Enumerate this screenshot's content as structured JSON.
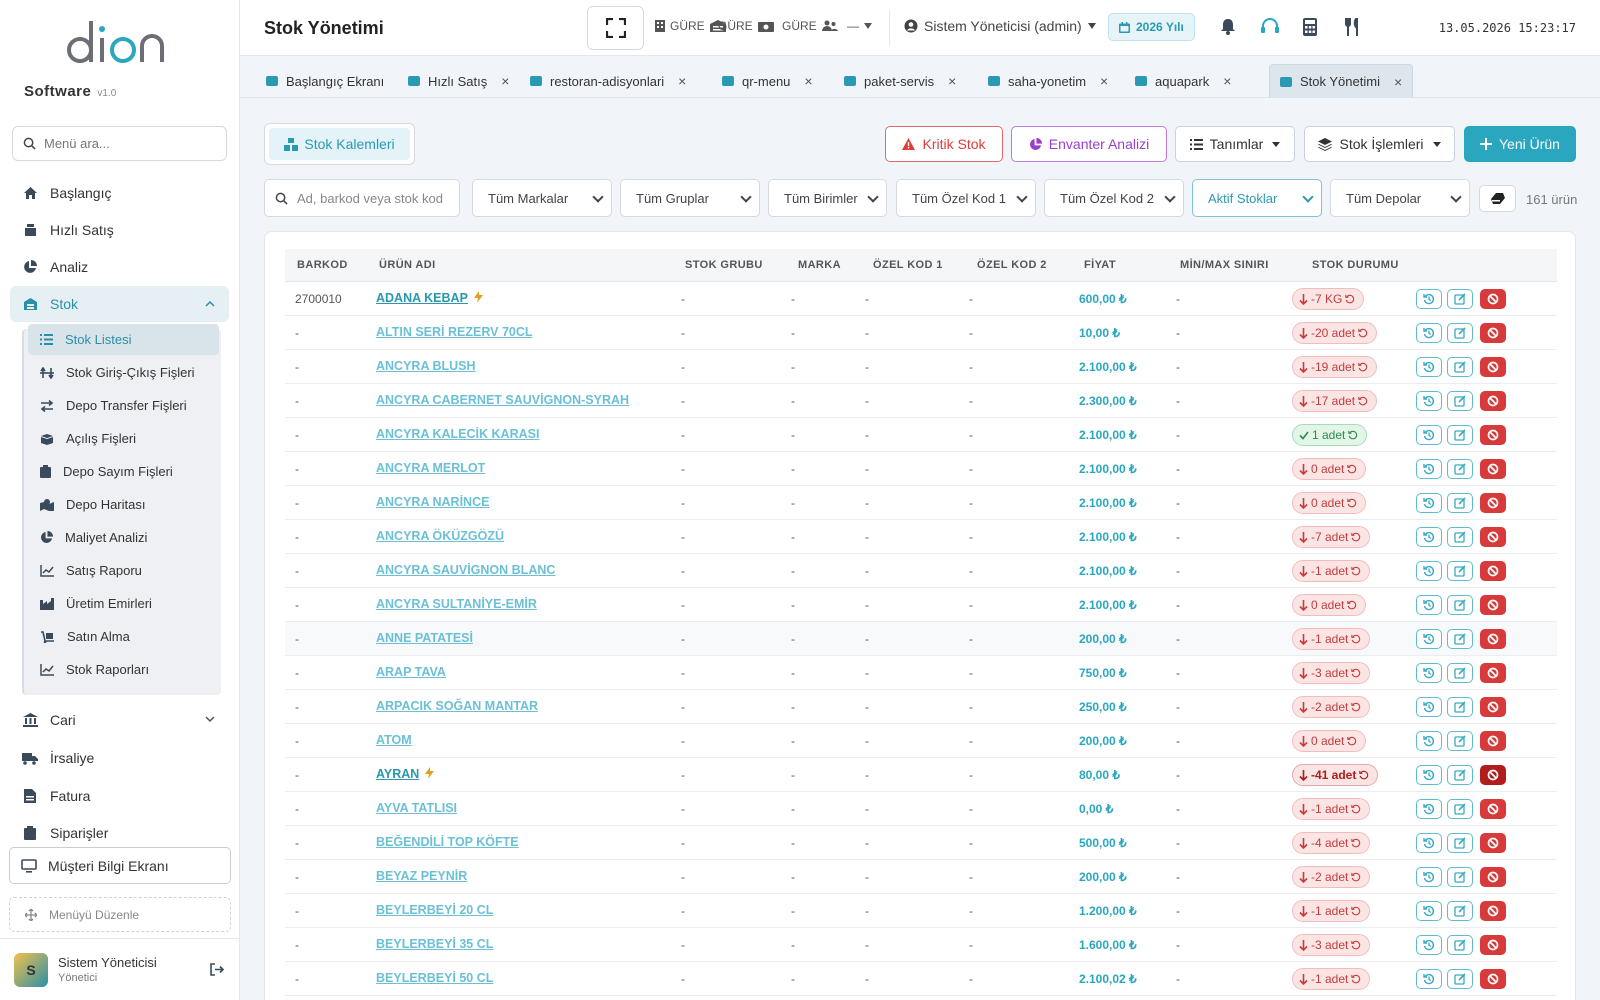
{
  "sidebar": {
    "brand": "Software",
    "version": "v1.0",
    "search_placeholder": "Menü ara...",
    "items": [
      {
        "label": "Başlangıç"
      },
      {
        "label": "Hızlı Satış"
      },
      {
        "label": "Analiz"
      },
      {
        "label": "Stok"
      },
      {
        "label": "Cari"
      },
      {
        "label": "İrsaliye"
      },
      {
        "label": "Fatura"
      },
      {
        "label": "Siparişler"
      }
    ],
    "submenu": [
      {
        "label": "Stok Listesi"
      },
      {
        "label": "Stok Giriş-Çıkış Fişleri"
      },
      {
        "label": "Depo Transfer Fişleri"
      },
      {
        "label": "Açılış Fişleri"
      },
      {
        "label": "Depo Sayım Fişleri"
      },
      {
        "label": "Depo Haritası"
      },
      {
        "label": "Maliyet Analizi"
      },
      {
        "label": "Satış Raporu"
      },
      {
        "label": "Üretim Emirleri"
      },
      {
        "label": "Satın Alma"
      },
      {
        "label": "Stok Raporları"
      }
    ],
    "customer_screen": "Müşteri Bilgi Ekranı",
    "edit_menu": "Menüyü Düzenle",
    "user": {
      "initial": "S",
      "name": "Sistem Yöneticisi",
      "role": "Yönetici"
    }
  },
  "topbar": {
    "title": "Stok Yönetimi",
    "stations": [
      "GÜRE",
      "GÜRE",
      "GÜRE",
      "—"
    ],
    "user": "Sistem Yöneticisi (admin)",
    "year": "2026 Yılı",
    "datetime": "13.05.2026 15:23:17"
  },
  "tabs": [
    {
      "label": "Başlangıç Ekranı"
    },
    {
      "label": "Hızlı Satış"
    },
    {
      "label": "restoran-adisyonlari"
    },
    {
      "label": "qr-menu"
    },
    {
      "label": "paket-servis"
    },
    {
      "label": "saha-yonetim"
    },
    {
      "label": "aquapark"
    },
    {
      "label": "Stok Yönetimi"
    }
  ],
  "toolbar": {
    "stock_items": "Stok Kalemleri",
    "critical": "Kritik Stok",
    "inventory": "Envanter Analizi",
    "definitions": "Tanımlar",
    "operations": "Stok İşlemleri",
    "new_product": "Yeni Ürün"
  },
  "filters": {
    "search_placeholder": "Ad, barkod veya stok kod",
    "brands": "Tüm Markalar",
    "groups": "Tüm Gruplar",
    "units": "Tüm Birimler",
    "code1": "Tüm Özel Kod 1",
    "code2": "Tüm Özel Kod 2",
    "status": "Aktif Stoklar",
    "warehouses": "Tüm Depolar",
    "count": "161 ürün"
  },
  "table": {
    "headers": [
      "BARKOD",
      "ÜRÜN ADI",
      "STOK GRUBU",
      "MARKA",
      "ÖZEL KOD 1",
      "ÖZEL KOD 2",
      "FİYAT",
      "MİN/MAX SINIRI",
      "STOK DURUMU"
    ],
    "rows": [
      {
        "barcode": "2700010",
        "name": "ADANA KEBAP",
        "group": "-",
        "brand": "-",
        "code1": "-",
        "code2": "-",
        "price": "600,00 ₺",
        "minmax": "-",
        "stock": "-7 KG"
      },
      {
        "barcode": "-",
        "name": "ALTIN SERİ REZERV 70CL",
        "group": "-",
        "brand": "-",
        "code1": "-",
        "code2": "-",
        "price": "10,00 ₺",
        "minmax": "-",
        "stock": "-20 adet"
      },
      {
        "barcode": "-",
        "name": "ANCYRA BLUSH",
        "group": "-",
        "brand": "-",
        "code1": "-",
        "code2": "-",
        "price": "2.100,00 ₺",
        "minmax": "-",
        "stock": "-19 adet"
      },
      {
        "barcode": "-",
        "name": "ANCYRA CABERNET SAUVİGNON-SYRAH",
        "group": "-",
        "brand": "-",
        "code1": "-",
        "code2": "-",
        "price": "2.300,00 ₺",
        "minmax": "-",
        "stock": "-17 adet"
      },
      {
        "barcode": "-",
        "name": "ANCYRA KALECİK KARASI",
        "group": "-",
        "brand": "-",
        "code1": "-",
        "code2": "-",
        "price": "2.100,00 ₺",
        "minmax": "-",
        "stock": "1 adet"
      },
      {
        "barcode": "-",
        "name": "ANCYRA MERLOT",
        "group": "-",
        "brand": "-",
        "code1": "-",
        "code2": "-",
        "price": "2.100,00 ₺",
        "minmax": "-",
        "stock": "0 adet"
      },
      {
        "barcode": "-",
        "name": "ANCYRA NARİNCE",
        "group": "-",
        "brand": "-",
        "code1": "-",
        "code2": "-",
        "price": "2.100,00 ₺",
        "minmax": "-",
        "stock": "0 adet"
      },
      {
        "barcode": "-",
        "name": "ANCYRA ÖKÜZGÖZÜ",
        "group": "-",
        "brand": "-",
        "code1": "-",
        "code2": "-",
        "price": "2.100,00 ₺",
        "minmax": "-",
        "stock": "-7 adet"
      },
      {
        "barcode": "-",
        "name": "ANCYRA SAUVİGNON BLANC",
        "group": "-",
        "brand": "-",
        "code1": "-",
        "code2": "-",
        "price": "2.100,00 ₺",
        "minmax": "-",
        "stock": "-1 adet"
      },
      {
        "barcode": "-",
        "name": "ANCYRA SULTANİYE-EMİR",
        "group": "-",
        "brand": "-",
        "code1": "-",
        "code2": "-",
        "price": "2.100,00 ₺",
        "minmax": "-",
        "stock": "0 adet"
      },
      {
        "barcode": "-",
        "name": "ANNE PATATESİ",
        "group": "-",
        "brand": "-",
        "code1": "-",
        "code2": "-",
        "price": "200,00 ₺",
        "minmax": "-",
        "stock": "-1 adet"
      },
      {
        "barcode": "-",
        "name": "ARAP TAVA",
        "group": "-",
        "brand": "-",
        "code1": "-",
        "code2": "-",
        "price": "750,00 ₺",
        "minmax": "-",
        "stock": "-3 adet"
      },
      {
        "barcode": "-",
        "name": "ARPACIK SOĞAN MANTAR",
        "group": "-",
        "brand": "-",
        "code1": "-",
        "code2": "-",
        "price": "250,00 ₺",
        "minmax": "-",
        "stock": "-2 adet"
      },
      {
        "barcode": "-",
        "name": "ATOM",
        "group": "-",
        "brand": "-",
        "code1": "-",
        "code2": "-",
        "price": "200,00 ₺",
        "minmax": "-",
        "stock": "0 adet"
      },
      {
        "barcode": "-",
        "name": "AYRAN",
        "group": "-",
        "brand": "-",
        "code1": "-",
        "code2": "-",
        "price": "80,00 ₺",
        "minmax": "-",
        "stock": "-41 adet"
      },
      {
        "barcode": "-",
        "name": "AYVA TATLISI",
        "group": "-",
        "brand": "-",
        "code1": "-",
        "code2": "-",
        "price": "0,00 ₺",
        "minmax": "-",
        "stock": "-1 adet"
      },
      {
        "barcode": "-",
        "name": "BEĞENDİLİ TOP KÖFTE",
        "group": "-",
        "brand": "-",
        "code1": "-",
        "code2": "-",
        "price": "500,00 ₺",
        "minmax": "-",
        "stock": "-4 adet"
      },
      {
        "barcode": "-",
        "name": "BEYAZ PEYNİR",
        "group": "-",
        "brand": "-",
        "code1": "-",
        "code2": "-",
        "price": "200,00 ₺",
        "minmax": "-",
        "stock": "-2 adet"
      },
      {
        "barcode": "-",
        "name": "BEYLERBEYİ 20 CL",
        "group": "-",
        "brand": "-",
        "code1": "-",
        "code2": "-",
        "price": "1.200,00 ₺",
        "minmax": "-",
        "stock": "-1 adet"
      },
      {
        "barcode": "-",
        "name": "BEYLERBEYİ 35 CL",
        "group": "-",
        "brand": "-",
        "code1": "-",
        "code2": "-",
        "price": "1.600,00 ₺",
        "minmax": "-",
        "stock": "-3 adet"
      },
      {
        "barcode": "-",
        "name": "BEYLERBEYİ 50 CL",
        "group": "-",
        "brand": "-",
        "code1": "-",
        "code2": "-",
        "price": "2.100,02 ₺",
        "minmax": "-",
        "stock": "-1 adet"
      }
    ]
  },
  "colors": {
    "accent": "#2aa7bf",
    "danger": "#d63a3a",
    "success": "#2e8a4c"
  }
}
